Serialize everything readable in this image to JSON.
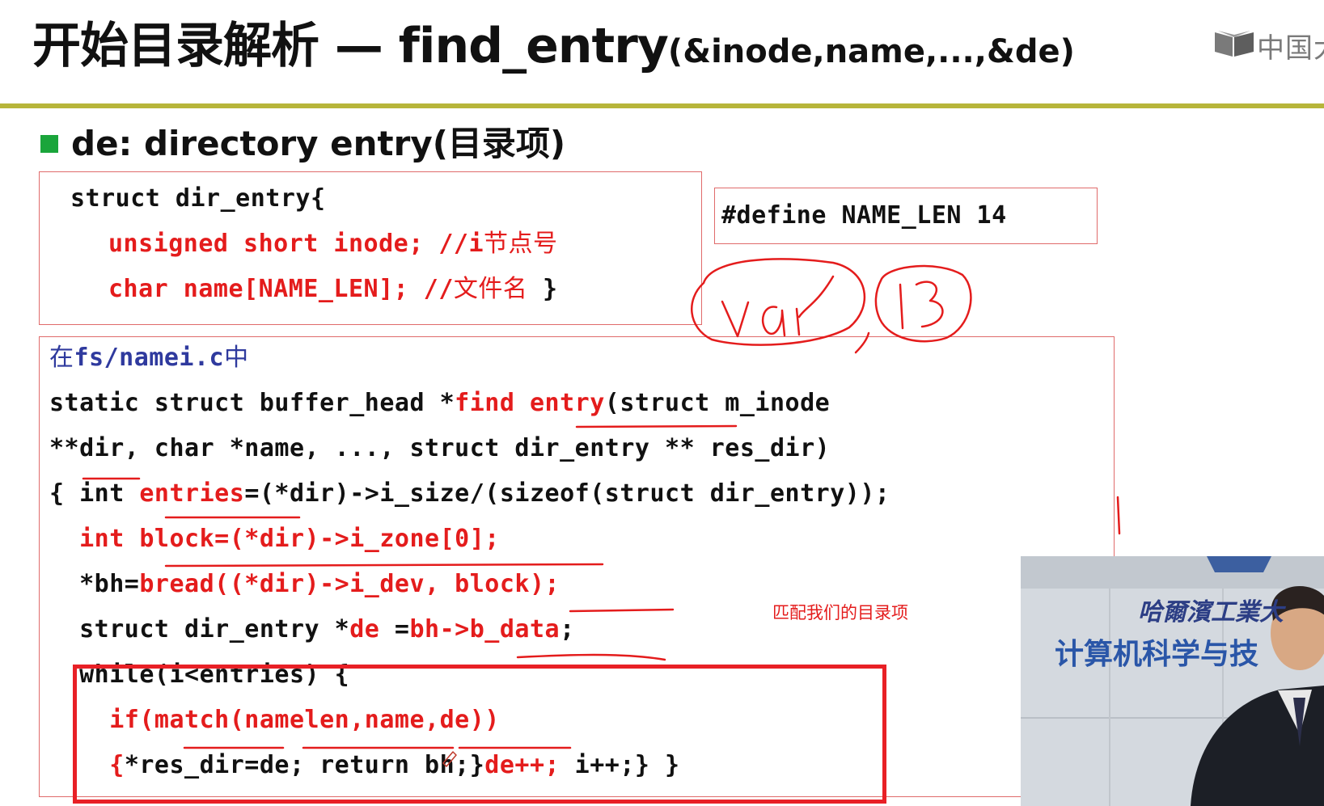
{
  "title": {
    "main": "开始目录解析 — find_entry",
    "sub": "(&inode,name,...,&de)"
  },
  "logo": {
    "text": "中国大"
  },
  "bullet": {
    "text": "de:  directory entry(目录项)"
  },
  "struct_box": {
    "line1": "struct dir_entry{",
    "line2_code": "unsigned short inode; //i",
    "line2_comment": "节点号",
    "line3_code": "char name[NAME_LEN]; //",
    "line3_comment": "文件名",
    "line3_end": " }"
  },
  "define_box": {
    "text": "#define NAME_LEN 14"
  },
  "handwriting": {
    "word": "var",
    "number": "13"
  },
  "code_box": {
    "file_prefix": "在",
    "file_name": "fs/namei.c",
    "file_suffix": "中",
    "l1_a": "static struct buffer_head *",
    "l1_fn": "find entry",
    "l1_b": "(struct m_inode",
    "l2": "**dir, char *name, ..., struct dir_entry ** res_dir)",
    "l3_a": "{ int ",
    "l3_var": "entries",
    "l3_b": "=(*dir)->i_size/(sizeof(struct dir_entry))",
    "l3_c": ";",
    "l4": "  int block=(*dir)->i_zone[0];",
    "l5_a": "  *bh=",
    "l5_b": "bread((*dir)->i_dev, block);",
    "l6_a": "  struct dir_entry *",
    "l6_var": "de",
    "l6_b": " =",
    "l6_c": "bh->b_data",
    "l6_d": ";",
    "l7": "  while(i<entries) {",
    "l8": "    if(match(namelen,name,de))",
    "l9_a": "    {",
    "l9_b": "*res_dir=de; return bh;}",
    "l9_c": "de++;",
    "l9_d": " i++;} }"
  },
  "note": {
    "text": "匹配我们的目录项"
  },
  "video": {
    "sign_line1": "哈爾濱工業大",
    "sign_line2": "计算机科学与技"
  },
  "colors": {
    "accent_rule": "#b7b53a",
    "bullet": "#1aa53b",
    "code_red": "#e41c1c",
    "box_border": "#e06b6b",
    "highlight_box": "#e82026",
    "file_blue": "#2f3a9e"
  }
}
